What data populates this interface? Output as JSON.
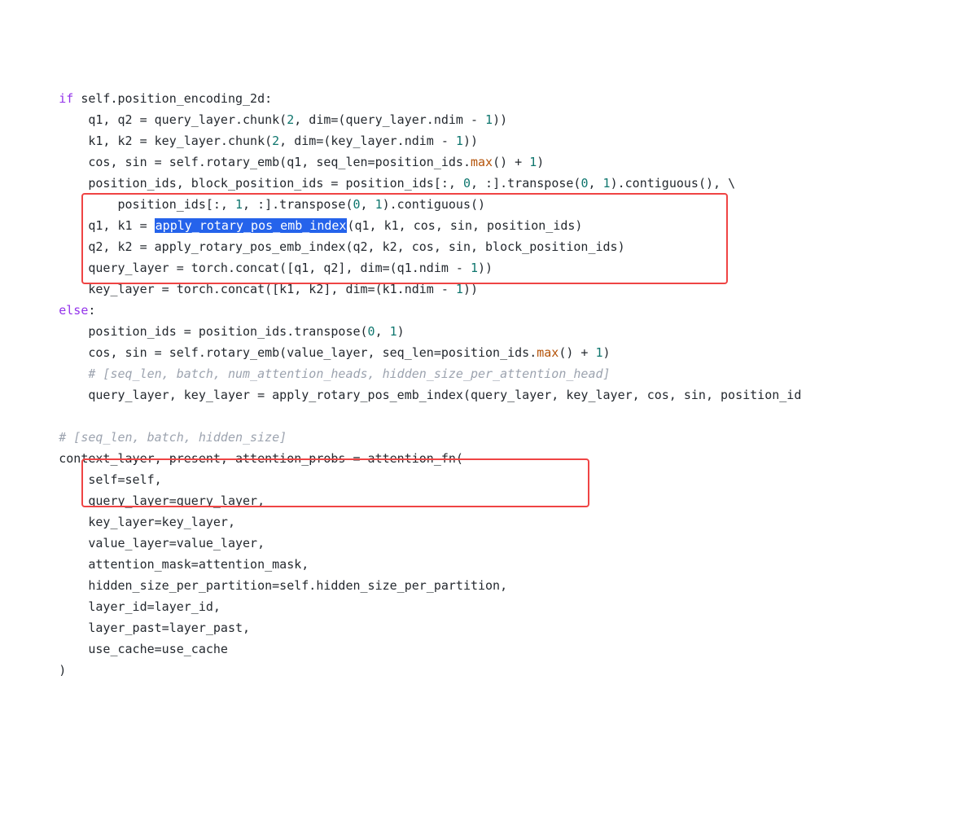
{
  "lines": {
    "l1a": "if",
    "l1b": " self.position_encoding_2d:",
    "l2a": "            q1, q2 = query_layer.chunk(",
    "l2n1": "2",
    "l2b": ", dim=(query_layer.ndim - ",
    "l2n2": "1",
    "l2c": "))",
    "l3a": "            k1, k2 = key_layer.chunk(",
    "l3n1": "2",
    "l3b": ", dim=(key_layer.ndim - ",
    "l3n2": "1",
    "l3c": "))",
    "l4a": "            cos, sin = self.rotary_emb(q1, seq_len=position_ids.",
    "l4fn": "max",
    "l4b": "() + ",
    "l4n": "1",
    "l4c": ")",
    "l5a": "            position_ids, block_position_ids = position_ids[:, ",
    "l5n1": "0",
    "l5b": ", :].transpose(",
    "l5n2": "0",
    "l5c": ", ",
    "l5n3": "1",
    "l5d": ").contiguous(), \\",
    "l6a": "                position_ids[:, ",
    "l6n1": "1",
    "l6b": ", :].transpose(",
    "l6n2": "0",
    "l6c": ", ",
    "l6n3": "1",
    "l6d": ").contiguous()",
    "l7a": "            q1, k1 = ",
    "l7hl": "apply_rotary_pos_emb_index",
    "l7b": "(q1, k1, cos, sin, position_ids)",
    "l8": "            q2, k2 = apply_rotary_pos_emb_index(q2, k2, cos, sin, block_position_ids)",
    "l9a": "            query_layer = torch.concat([q1, q2], dim=(q1.ndim - ",
    "l9n": "1",
    "l9b": "))",
    "l10a": "            key_layer = torch.concat([k1, k2], dim=(k1.ndim - ",
    "l10n": "1",
    "l10b": "))",
    "l11a": "else",
    "l11b": ":",
    "l12a": "            position_ids = position_ids.transpose(",
    "l12n1": "0",
    "l12b": ", ",
    "l12n2": "1",
    "l12c": ")",
    "l13a": "            cos, sin = self.rotary_emb(value_layer, seq_len=position_ids.",
    "l13fn": "max",
    "l13b": "() + ",
    "l13n": "1",
    "l13c": ")",
    "l14": "            # [seq_len, batch, num_attention_heads, hidden_size_per_attention_head]",
    "l15": "            query_layer, key_layer = apply_rotary_pos_emb_index(query_layer, key_layer, cos, sin, position_id",
    "l16": "",
    "l17": "        # [seq_len, batch, hidden_size]",
    "l18": "        context_layer, present, attention_probs = attention_fn(",
    "l19": "            self=self,",
    "l20": "            query_layer=query_layer,",
    "l21": "            key_layer=key_layer,",
    "l22": "            value_layer=value_layer,",
    "l23": "            attention_mask=attention_mask,",
    "l24": "            hidden_size_per_partition=self.hidden_size_per_partition,",
    "l25": "            layer_id=layer_id,",
    "l26": "            layer_past=layer_past,",
    "l27": "            use_cache=use_cache",
    "l28": "        )"
  }
}
